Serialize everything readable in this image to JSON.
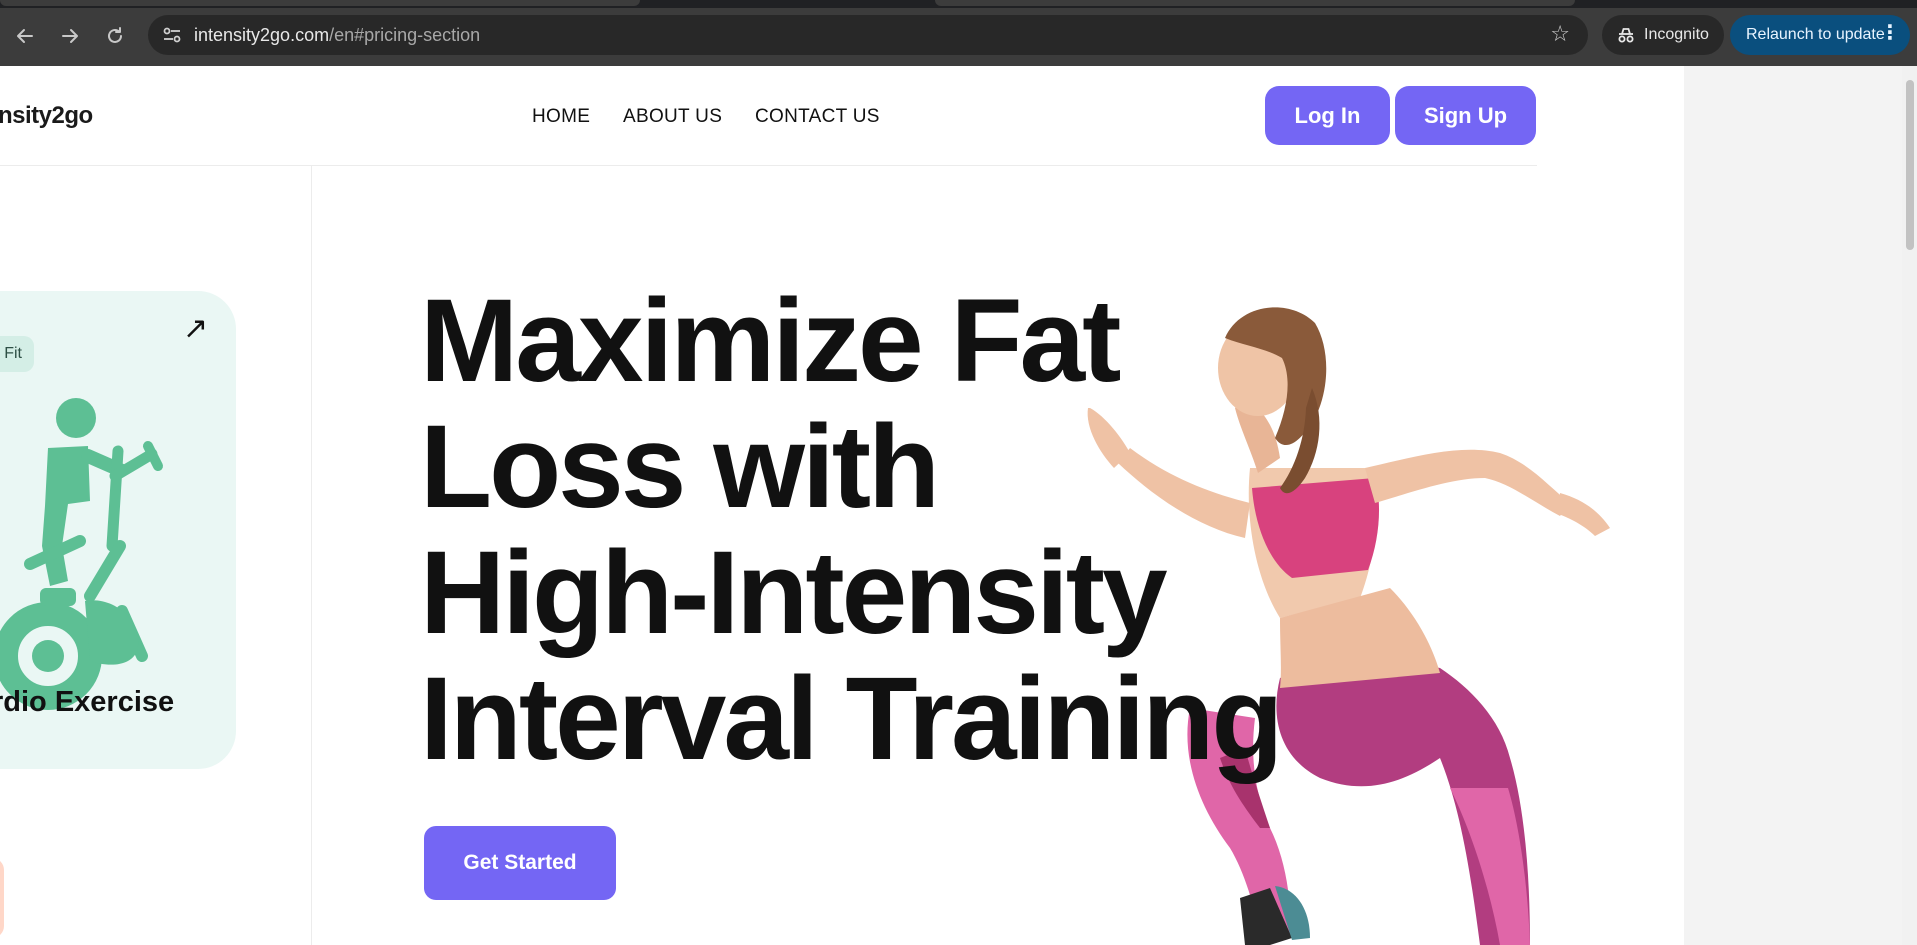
{
  "browser": {
    "url_host": "intensity2go.com",
    "url_path": "/en#pricing-section",
    "profile_label": "Incognito",
    "update_label": "Relaunch to update",
    "back_icon": "arrow-back-icon",
    "forward_icon": "arrow-forward-icon",
    "reload_icon": "reload-icon",
    "bookmark_icon": "star-icon"
  },
  "site": {
    "logo_text": "nsity2go",
    "nav": [
      "HOME",
      "ABOUT US",
      "CONTACT US"
    ],
    "login_label": "Log In",
    "signup_label": "Sign Up",
    "accent_color": "#7466f4"
  },
  "card": {
    "tag": "Fit",
    "title": "rdio Exercise",
    "icon": "exercise-bike-icon",
    "bg_color": "#eaf7f4",
    "icon_color": "#5dbf94"
  },
  "hero": {
    "headline_lines": [
      "Maximize Fat",
      "Loss with",
      "High-Intensity",
      "Interval Training"
    ],
    "cta_label": "Get Started"
  }
}
